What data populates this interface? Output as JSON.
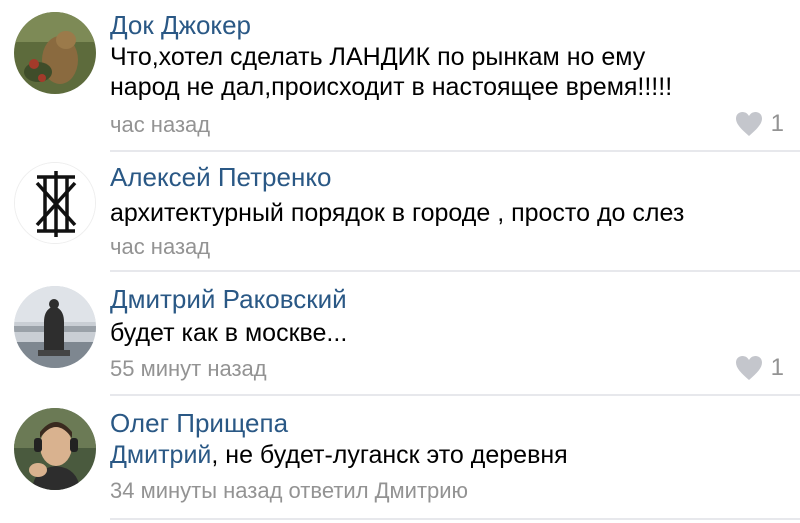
{
  "comments": [
    {
      "author": "Док Джокер",
      "text_line1": "Что,хотел сделать ЛАНДИК по рынкам но ему",
      "text_line2": "народ не дал,происходит в настоящее время!!!!!",
      "time": "час назад",
      "likes": "1",
      "avatar_icon": "squirrel-photo"
    },
    {
      "author": "Алексей Петренко",
      "text_line1": "архитектурный порядок в городе , просто до слез",
      "time": "час назад",
      "avatar_icon": "monogram-logo"
    },
    {
      "author": "Дмитрий Раковский",
      "text_line1": "будет как в москве...",
      "time": "55 минут назад",
      "likes": "1",
      "avatar_icon": "monument-photo"
    },
    {
      "author": "Олег Прищепа",
      "mention": "Дмитрий",
      "text_rest": ", не будет-луганск это деревня",
      "time": "34 минуты назад ответил Дмитрию",
      "avatar_icon": "man-headphones-photo"
    }
  ],
  "colors": {
    "author": "#2a5885",
    "meta": "#939393",
    "divider": "#e7e8ec",
    "heart": "#c4c6cc"
  }
}
